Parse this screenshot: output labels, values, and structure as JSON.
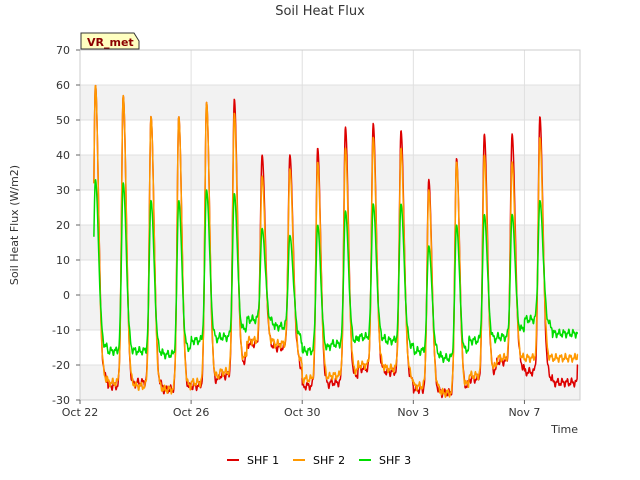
{
  "chart_data": {
    "type": "line",
    "title": "Soil Heat Flux",
    "xlabel": "Time",
    "ylabel": "Soil Heat Flux (W/m2)",
    "badge": "VR_met",
    "ylim": [
      -30,
      70
    ],
    "yticks": [
      -30,
      -20,
      -10,
      0,
      10,
      20,
      30,
      40,
      50,
      60,
      70
    ],
    "xlim": [
      "2023-10-22",
      "2023-11-09"
    ],
    "xticks": [
      {
        "date": "2023-10-22",
        "label": "Oct 22"
      },
      {
        "date": "2023-10-26",
        "label": "Oct 26"
      },
      {
        "date": "2023-10-30",
        "label": "Oct 30"
      },
      {
        "date": "2023-11-03",
        "label": "Nov 3"
      },
      {
        "date": "2023-11-07",
        "label": "Nov 7"
      }
    ],
    "grid": true,
    "legend_position": "bottom",
    "days": [
      "Oct 22",
      "Oct 23",
      "Oct 24",
      "Oct 25",
      "Oct 26",
      "Oct 27",
      "Oct 28",
      "Oct 29",
      "Oct 30",
      "Oct 31",
      "Nov 1",
      "Nov 2",
      "Nov 3",
      "Nov 4",
      "Nov 5",
      "Nov 6",
      "Nov 7",
      "Nov 8"
    ],
    "series": [
      {
        "name": "SHF 1",
        "color": "#dd0000",
        "daily_peak": [
          60,
          57,
          51,
          51,
          55,
          56,
          40,
          40,
          42,
          48,
          49,
          47,
          33,
          39,
          46,
          46,
          51,
          null
        ],
        "daily_min": [
          -22,
          -26,
          -25,
          -27,
          -26,
          -23,
          -14,
          -15,
          -26,
          -25,
          -21,
          -22,
          -27,
          -28,
          -24,
          -19,
          -22,
          -25
        ],
        "last_value": -20
      },
      {
        "name": "SHF 2",
        "color": "#ff9900",
        "daily_peak": [
          60,
          57,
          51,
          51,
          55,
          52,
          34,
          36,
          38,
          42,
          45,
          42,
          30,
          38,
          40,
          38,
          45,
          null
        ],
        "daily_min": [
          -23,
          -25,
          -26,
          -27,
          -25,
          -22,
          -13,
          -14,
          -24,
          -23,
          -20,
          -21,
          -26,
          -28,
          -23,
          -18,
          -18,
          -18
        ],
        "last_value": -17
      },
      {
        "name": "SHF 3",
        "color": "#00dd00",
        "daily_peak": [
          33,
          32,
          27,
          27,
          30,
          29,
          19,
          17,
          20,
          24,
          26,
          26,
          14,
          20,
          23,
          23,
          27,
          null
        ],
        "daily_min": [
          -14,
          -16,
          -16,
          -17,
          -13,
          -12,
          -7,
          -9,
          -16,
          -14,
          -12,
          -13,
          -16,
          -18,
          -13,
          -12,
          -7,
          -11
        ],
        "last_value": -11
      }
    ]
  }
}
